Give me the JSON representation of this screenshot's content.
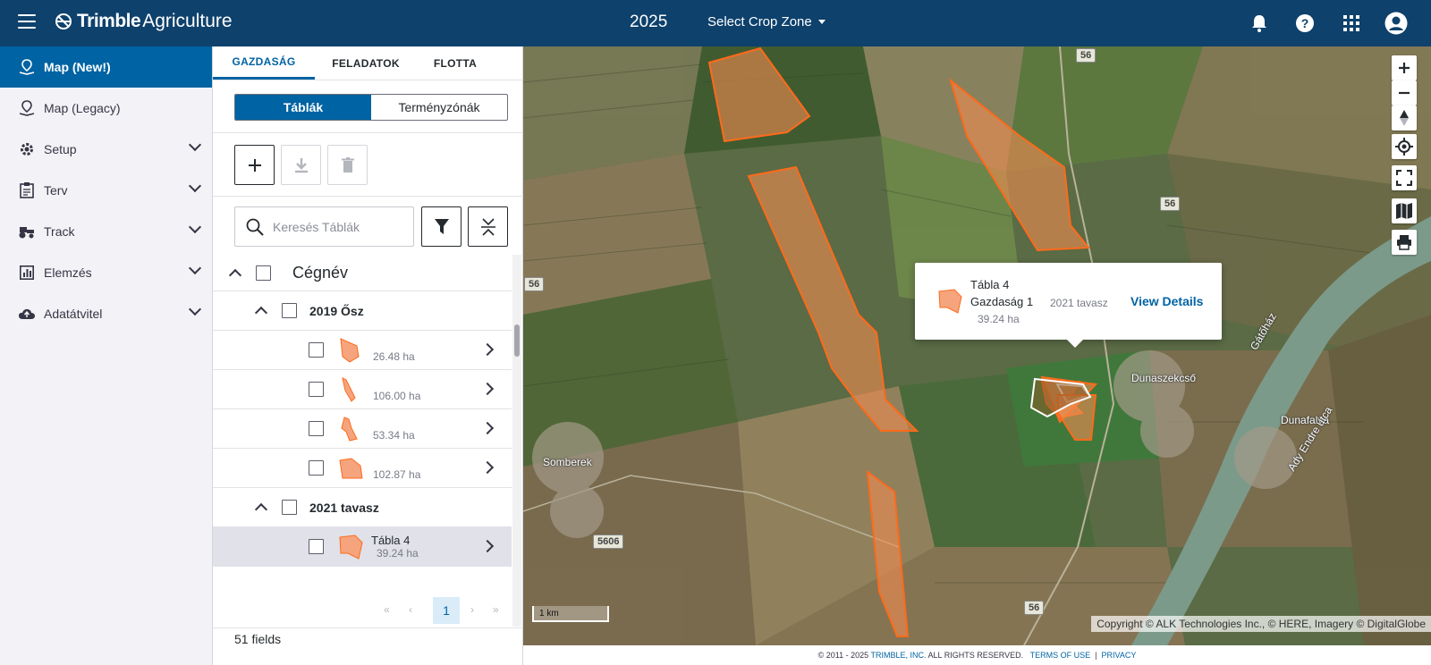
{
  "header": {
    "brand": "Trimble",
    "product": "Agriculture",
    "year": "2025",
    "crop_zone_label": "Select Crop Zone"
  },
  "sidebar": {
    "items": [
      {
        "label": "Map (New!)",
        "icon": "map-pin-icon",
        "active": true
      },
      {
        "label": "Map (Legacy)",
        "icon": "map-pin-icon"
      },
      {
        "label": "Setup",
        "icon": "gear-icon",
        "expandable": true
      },
      {
        "label": "Terv",
        "icon": "clipboard-icon",
        "expandable": true
      },
      {
        "label": "Track",
        "icon": "tractor-icon",
        "expandable": true
      },
      {
        "label": "Elemzés",
        "icon": "chart-icon",
        "expandable": true
      },
      {
        "label": "Adatátvitel",
        "icon": "cloud-icon",
        "expandable": true
      }
    ]
  },
  "panel": {
    "tabs": [
      "GAZDASÁG",
      "FELADATOK",
      "FLOTTA"
    ],
    "segment": [
      "Táblák",
      "Terményzónák"
    ],
    "search_placeholder": "Keresés Táblák",
    "root_group": "Cégnév",
    "groups": [
      {
        "label": "2019 Ősz",
        "fields": [
          {
            "name": "",
            "area": "26.48 ha"
          },
          {
            "name": "",
            "area": "106.00 ha"
          },
          {
            "name": "",
            "area": "53.34 ha"
          },
          {
            "name": "",
            "area": "102.87 ha"
          }
        ]
      },
      {
        "label": "2021 tavasz",
        "fields": [
          {
            "name": "Tábla 4",
            "area": "39.24 ha",
            "selected": true
          }
        ]
      }
    ],
    "pagination": {
      "first": "«",
      "prev": "‹",
      "current": "1",
      "next": "›",
      "last": "»"
    },
    "field_count": "51 fields"
  },
  "map": {
    "popup": {
      "title": "Tábla 4",
      "farm": "Gazdaság 1",
      "season": "2021 tavasz",
      "area": "39.24 ha",
      "link": "View Details"
    },
    "scale": "1 km",
    "copyright": "Copyright © ALK Technologies Inc., © HERE, Imagery © DigitalGlobe",
    "labels": [
      "Somberek",
      "Dunaszekcső",
      "Dunafalva",
      "Ady Endre utca",
      "Gátőház"
    ],
    "roads": [
      "56",
      "56",
      "5606",
      "56",
      "56"
    ],
    "field_color": "#f28c52",
    "field_outline": "#ff6a1a"
  },
  "footer": {
    "copyright": "© 2011 - 2025",
    "company": "TRIMBLE, INC.",
    "rights": "ALL RIGHTS RESERVED.",
    "terms": "TERMS OF USE",
    "divider": "|",
    "privacy": "PRIVACY"
  }
}
